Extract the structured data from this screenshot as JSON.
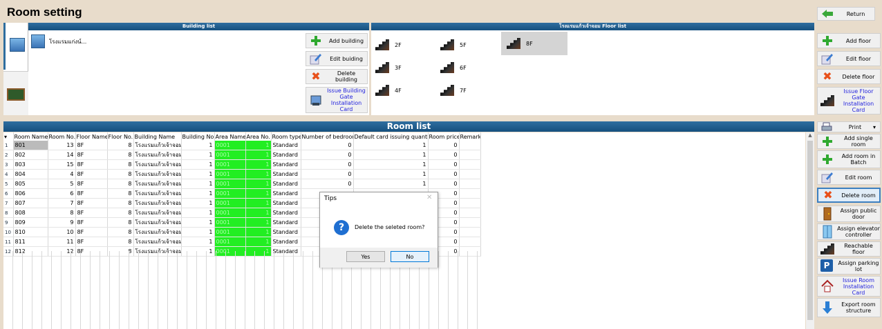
{
  "page_title": "Room setting",
  "return_label": "Return",
  "building_panel": {
    "header": "Building list",
    "building_name": "โรงแรมแก่งน์...",
    "buttons": {
      "add": "Add building",
      "edit": "Edit buiding",
      "delete": "Delete building",
      "issue": "Issue Building Gate Installation Card"
    }
  },
  "floor_panel": {
    "header": "โรงแรมแก้วเจ้าจอม Floor list",
    "floors": [
      "2F",
      "3F",
      "4F",
      "5F",
      "6F",
      "7F",
      "8F"
    ],
    "selected_floor": "8F",
    "buttons": {
      "add": "Add floor",
      "edit": "Edit floor",
      "delete": "Delete floor",
      "issue": "Issue Floor Gate Installation Card"
    }
  },
  "room_list": {
    "header": "Room list",
    "columns": [
      "Room Name",
      "Room No.",
      "Floor Name",
      "Floor No.",
      "Building Name",
      "Building No.",
      "Area Name",
      "Area No.",
      "Room type",
      "Number of bedroom",
      "Default card issuing quantity",
      "Room price",
      "Remark"
    ],
    "rows": [
      {
        "idx": "1",
        "name": "801",
        "room_no": "13",
        "floor_name": "8F",
        "floor_no": "8",
        "building": "โรงแรมแก้วเจ้าจอม",
        "building_no": "1",
        "area": "0001",
        "area_no": "1",
        "type": "Standard",
        "bedrooms": "0",
        "cards": "1",
        "price": "0"
      },
      {
        "idx": "2",
        "name": "802",
        "room_no": "14",
        "floor_name": "8F",
        "floor_no": "8",
        "building": "โรงแรมแก้วเจ้าจอม",
        "building_no": "1",
        "area": "0001",
        "area_no": "1",
        "type": "Standard",
        "bedrooms": "0",
        "cards": "1",
        "price": "0"
      },
      {
        "idx": "3",
        "name": "803",
        "room_no": "15",
        "floor_name": "8F",
        "floor_no": "8",
        "building": "โรงแรมแก้วเจ้าจอม",
        "building_no": "1",
        "area": "0001",
        "area_no": "1",
        "type": "Standard",
        "bedrooms": "0",
        "cards": "1",
        "price": "0"
      },
      {
        "idx": "4",
        "name": "804",
        "room_no": "4",
        "floor_name": "8F",
        "floor_no": "8",
        "building": "โรงแรมแก้วเจ้าจอม",
        "building_no": "1",
        "area": "0001",
        "area_no": "1",
        "type": "Standard",
        "bedrooms": "0",
        "cards": "1",
        "price": "0"
      },
      {
        "idx": "5",
        "name": "805",
        "room_no": "5",
        "floor_name": "8F",
        "floor_no": "8",
        "building": "โรงแรมแก้วเจ้าจอม",
        "building_no": "1",
        "area": "0001",
        "area_no": "1",
        "type": "Standard",
        "bedrooms": "0",
        "cards": "1",
        "price": "0"
      },
      {
        "idx": "6",
        "name": "806",
        "room_no": "6",
        "floor_name": "8F",
        "floor_no": "8",
        "building": "โรงแรมแก้วเจ้าจอม",
        "building_no": "1",
        "area": "0001",
        "area_no": "1",
        "type": "Standard",
        "bedrooms": "",
        "cards": "",
        "price": "0"
      },
      {
        "idx": "7",
        "name": "807",
        "room_no": "7",
        "floor_name": "8F",
        "floor_no": "8",
        "building": "โรงแรมแก้วเจ้าจอม",
        "building_no": "1",
        "area": "0001",
        "area_no": "1",
        "type": "Standard",
        "bedrooms": "",
        "cards": "",
        "price": "0"
      },
      {
        "idx": "8",
        "name": "808",
        "room_no": "8",
        "floor_name": "8F",
        "floor_no": "8",
        "building": "โรงแรมแก้วเจ้าจอม",
        "building_no": "1",
        "area": "0001",
        "area_no": "1",
        "type": "Standard",
        "bedrooms": "",
        "cards": "",
        "price": "0"
      },
      {
        "idx": "9",
        "name": "809",
        "room_no": "9",
        "floor_name": "8F",
        "floor_no": "8",
        "building": "โรงแรมแก้วเจ้าจอม",
        "building_no": "1",
        "area": "0001",
        "area_no": "1",
        "type": "Standard",
        "bedrooms": "",
        "cards": "",
        "price": "0"
      },
      {
        "idx": "10",
        "name": "810",
        "room_no": "10",
        "floor_name": "8F",
        "floor_no": "8",
        "building": "โรงแรมแก้วเจ้าจอม",
        "building_no": "1",
        "area": "0001",
        "area_no": "1",
        "type": "Standard",
        "bedrooms": "",
        "cards": "",
        "price": "0"
      },
      {
        "idx": "11",
        "name": "811",
        "room_no": "11",
        "floor_name": "8F",
        "floor_no": "8",
        "building": "โรงแรมแก้วเจ้าจอม",
        "building_no": "1",
        "area": "0001",
        "area_no": "1",
        "type": "Standard",
        "bedrooms": "",
        "cards": "",
        "price": "0"
      },
      {
        "idx": "12",
        "name": "812",
        "room_no": "12",
        "floor_name": "8F",
        "floor_no": "8",
        "building": "โรงแรมแก้วเจ้าจอม",
        "building_no": "1",
        "area": "0001",
        "area_no": "1",
        "type": "Standard",
        "bedrooms": "",
        "cards": "",
        "price": "0"
      }
    ]
  },
  "print_label": "Print",
  "room_buttons": {
    "add_single": "Add single room",
    "add_batch": "Add room in Batch",
    "edit": "Edit room",
    "delete": "Delete room",
    "assign_public_door": "Assign public door",
    "assign_elevator": "Assign elevator controller",
    "reachable_floor": "Reachable floor",
    "assign_parking": "Assign parking lot",
    "issue_room_card": "Issue Room Installation Card",
    "export": "Export room structure"
  },
  "dialog": {
    "title": "Tips",
    "message": "Delete the seleted room?",
    "yes": "Yes",
    "no": "No"
  }
}
